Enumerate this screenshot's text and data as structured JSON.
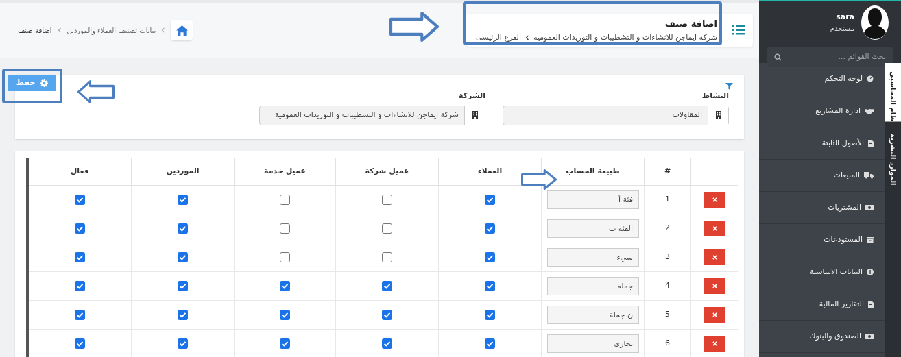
{
  "header": {
    "breadcrumb": [
      "بيانات تصنيف العملاء والموردين",
      "اضافة صنف"
    ],
    "title": "اضافة صنف",
    "subtitle": {
      "company": "شركة ايماجن للانشاءات و التشطيبات و التوريدات العمومية",
      "branch": "الفرع الرئيسى"
    }
  },
  "toolbar": {
    "save_button": "حفظ"
  },
  "filters": [
    {
      "label": "النشاط",
      "value": "المقاولات"
    },
    {
      "label": "الشركة",
      "value": "شركة ايماجن للانشاءات و التشطيبات و التوريدات العمومية"
    }
  ],
  "table": {
    "columns": [
      "#",
      "طبيعة الحساب",
      "العملاء",
      "عميل شركة",
      "عميل خدمة",
      "الموردين",
      "فعال"
    ],
    "rows": [
      {
        "number": "1",
        "account_type": "فئة أ",
        "checks": [
          true,
          false,
          false,
          true,
          true
        ]
      },
      {
        "number": "2",
        "account_type": "الفئة ب",
        "checks": [
          true,
          false,
          false,
          true,
          true
        ]
      },
      {
        "number": "3",
        "account_type": "سيء",
        "checks": [
          true,
          false,
          false,
          true,
          true
        ]
      },
      {
        "number": "4",
        "account_type": "جمله",
        "checks": [
          true,
          true,
          true,
          true,
          true
        ]
      },
      {
        "number": "5",
        "account_type": "ن جملة",
        "checks": [
          true,
          true,
          true,
          true,
          true
        ]
      },
      {
        "number": "6",
        "account_type": "تجارى",
        "checks": [
          true,
          true,
          true,
          true,
          true
        ]
      }
    ]
  },
  "sidebar": {
    "user": {
      "name": "sara",
      "role": "مستخدم"
    },
    "search": {
      "placeholder": "بحث القوائم ..."
    },
    "items": [
      {
        "label": "لوحة التحكم",
        "kind": "gauge"
      },
      {
        "label": "ادارة المشاريع",
        "kind": "handshake"
      },
      {
        "label": "الأصول الثابتة",
        "kind": "file"
      },
      {
        "label": "المبيعات",
        "kind": "truck"
      },
      {
        "label": "المشتريات",
        "kind": "money"
      },
      {
        "label": "المستودعات",
        "kind": "archive"
      },
      {
        "label": "البيانات الاساسية",
        "kind": "info"
      },
      {
        "label": "التقارير المالية",
        "kind": "file"
      },
      {
        "label": "الصندوق والبنوك",
        "kind": "money"
      }
    ],
    "tabs": [
      {
        "label": "ظام المحاسبي",
        "selected": true
      },
      {
        "label": "الموارد البشرية",
        "selected": false
      }
    ]
  }
}
